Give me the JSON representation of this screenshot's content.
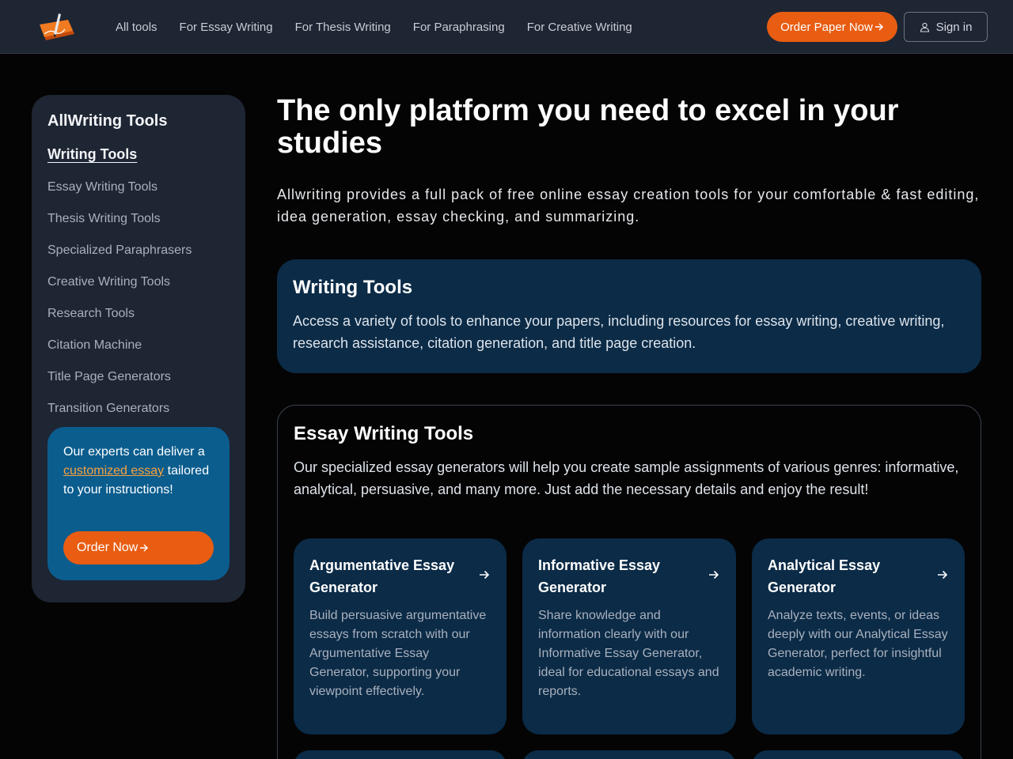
{
  "header": {
    "logo_icon": "pen-on-paper-logo",
    "nav": [
      "All tools",
      "For Essay Writing",
      "For Thesis Writing",
      "For Paraphrasing",
      "For Creative Writing"
    ],
    "order_label": "Order Paper Now",
    "signin_label": "Sign in",
    "accent": "#e85d12"
  },
  "sidebar": {
    "title": "AllWriting Tools",
    "section": "Writing Tools",
    "items": [
      "Essay Writing Tools",
      "Thesis Writing Tools",
      "Specialized Paraphrasers",
      "Creative Writing Tools",
      "Research Tools",
      "Citation Machine",
      "Title Page Generators",
      "Transition Generators"
    ],
    "promo": {
      "text_before": "Our experts can deliver a ",
      "link": "customized essay",
      "text_after": " tailored to your instructions!",
      "button": "Order Now"
    }
  },
  "main": {
    "title": "The only platform you need to excel in your studies",
    "subtitle": "Allwriting provides a full pack of free online essay creation tools for your comfortable & fast editing, idea generation, essay checking, and summarizing.",
    "writing_tools": {
      "title": "Writing Tools",
      "description": "Access a variety of tools to enhance your papers, including resources for essay writing, creative writing, research assistance, citation generation, and title page creation."
    },
    "essay_tools": {
      "title": "Essay Writing Tools",
      "description": "Our specialized essay generators will help you create sample assignments of various genres: informative, analytical, persuasive, and many more. Just add the necessary details and enjoy the result!",
      "cards": [
        {
          "title": "Argumentative Essay Generator",
          "description": "Build persuasive argumentative essays from scratch with our Argumentative Essay Generator, supporting your viewpoint effectively."
        },
        {
          "title": "Informative Essay Generator",
          "description": "Share knowledge and information clearly with our Informative Essay Generator, ideal for educational essays and reports."
        },
        {
          "title": "Analytical Essay Generator",
          "description": "Analyze texts, events, or ideas deeply with our Analytical Essay Generator, perfect for insightful academic writing."
        }
      ]
    }
  }
}
